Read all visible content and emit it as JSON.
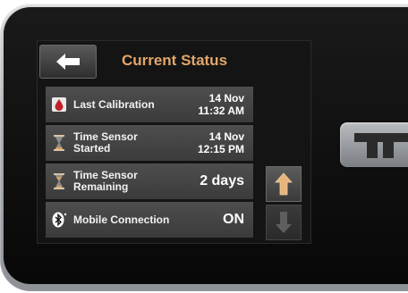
{
  "header": {
    "title": "Current Status"
  },
  "rows": [
    {
      "label": "Last Calibration",
      "value_line1": "14 Nov",
      "value_line2": "11:32 AM",
      "icon": "blood-drop-icon"
    },
    {
      "label": "Time Sensor Started",
      "value_line1": "14 Nov",
      "value_line2": "12:15 PM",
      "icon": "hourglass-icon"
    },
    {
      "label": "Time Sensor Remaining",
      "value": "2 days",
      "icon": "hourglass-icon"
    },
    {
      "label": "Mobile Connection",
      "value": "ON",
      "icon": "bluetooth-icon"
    }
  ],
  "colors": {
    "title": "#e3a66a",
    "scroll_up_arrow": "#e8b57c",
    "drop": "#c0212b"
  },
  "icons": {
    "back": "left-arrow-icon",
    "scroll_up": "up-arrow-icon",
    "scroll_down": "down-arrow-icon"
  }
}
